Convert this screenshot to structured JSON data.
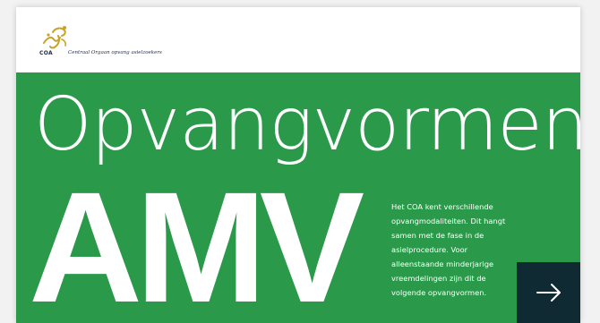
{
  "header": {
    "logo_abbr": "COA",
    "logo_full": "Centraal Orgaan opvang asielzoekers"
  },
  "hero": {
    "title": "Opvangvormen",
    "big_label": "AMV",
    "text": "Het COA kent verschillende opvangmodaliteiten. Dit hangt samen met de fase in de asielprocedure. Voor alleenstaande minderjarige vreemdelingen zijn dit de volgende opvangvormen.",
    "next_icon": "arrow-right-icon"
  },
  "colors": {
    "brand_green": "#2a9a4a",
    "dark_button": "#0f2a33",
    "logo_gold": "#c9a227",
    "logo_navy": "#1a2a4a"
  }
}
